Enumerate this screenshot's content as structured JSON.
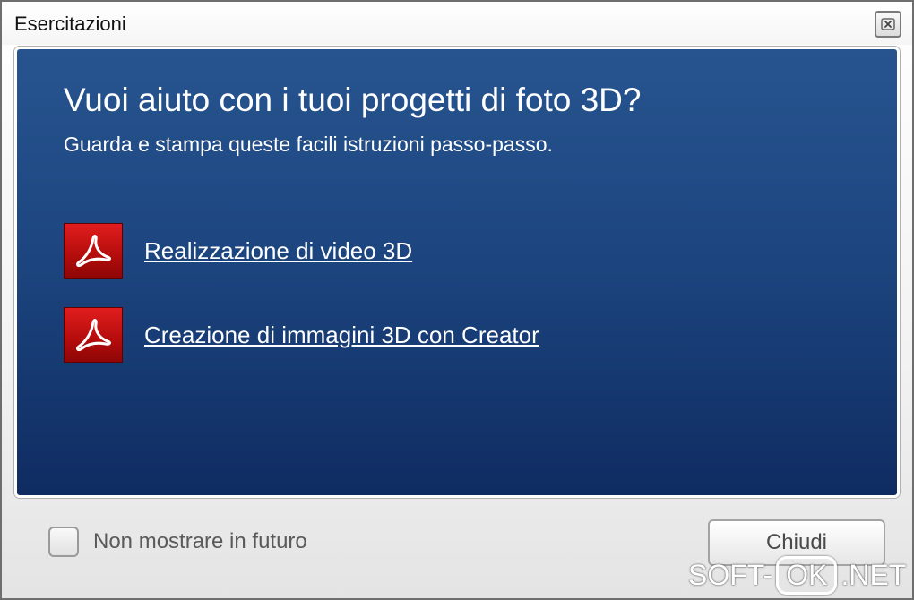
{
  "window": {
    "title": "Esercitazioni"
  },
  "content": {
    "heading": "Vuoi aiuto con i tuoi progetti di foto 3D?",
    "subheading": "Guarda e stampa queste facili istruzioni passo-passo.",
    "tutorials": [
      {
        "label": "Realizzazione di video 3D",
        "icon": "pdf-icon"
      },
      {
        "label": "Creazione di immagini 3D con Creator",
        "icon": "pdf-icon"
      }
    ]
  },
  "footer": {
    "checkbox_label": "Non mostrare in futuro",
    "checkbox_checked": false,
    "close_label": "Chiudi"
  },
  "watermark": {
    "left": "SOFT-",
    "box": "OK",
    "right": ".NET"
  },
  "colors": {
    "panel_top": "#27548f",
    "panel_bottom": "#0f2c62",
    "pdf_red": "#c41212"
  }
}
